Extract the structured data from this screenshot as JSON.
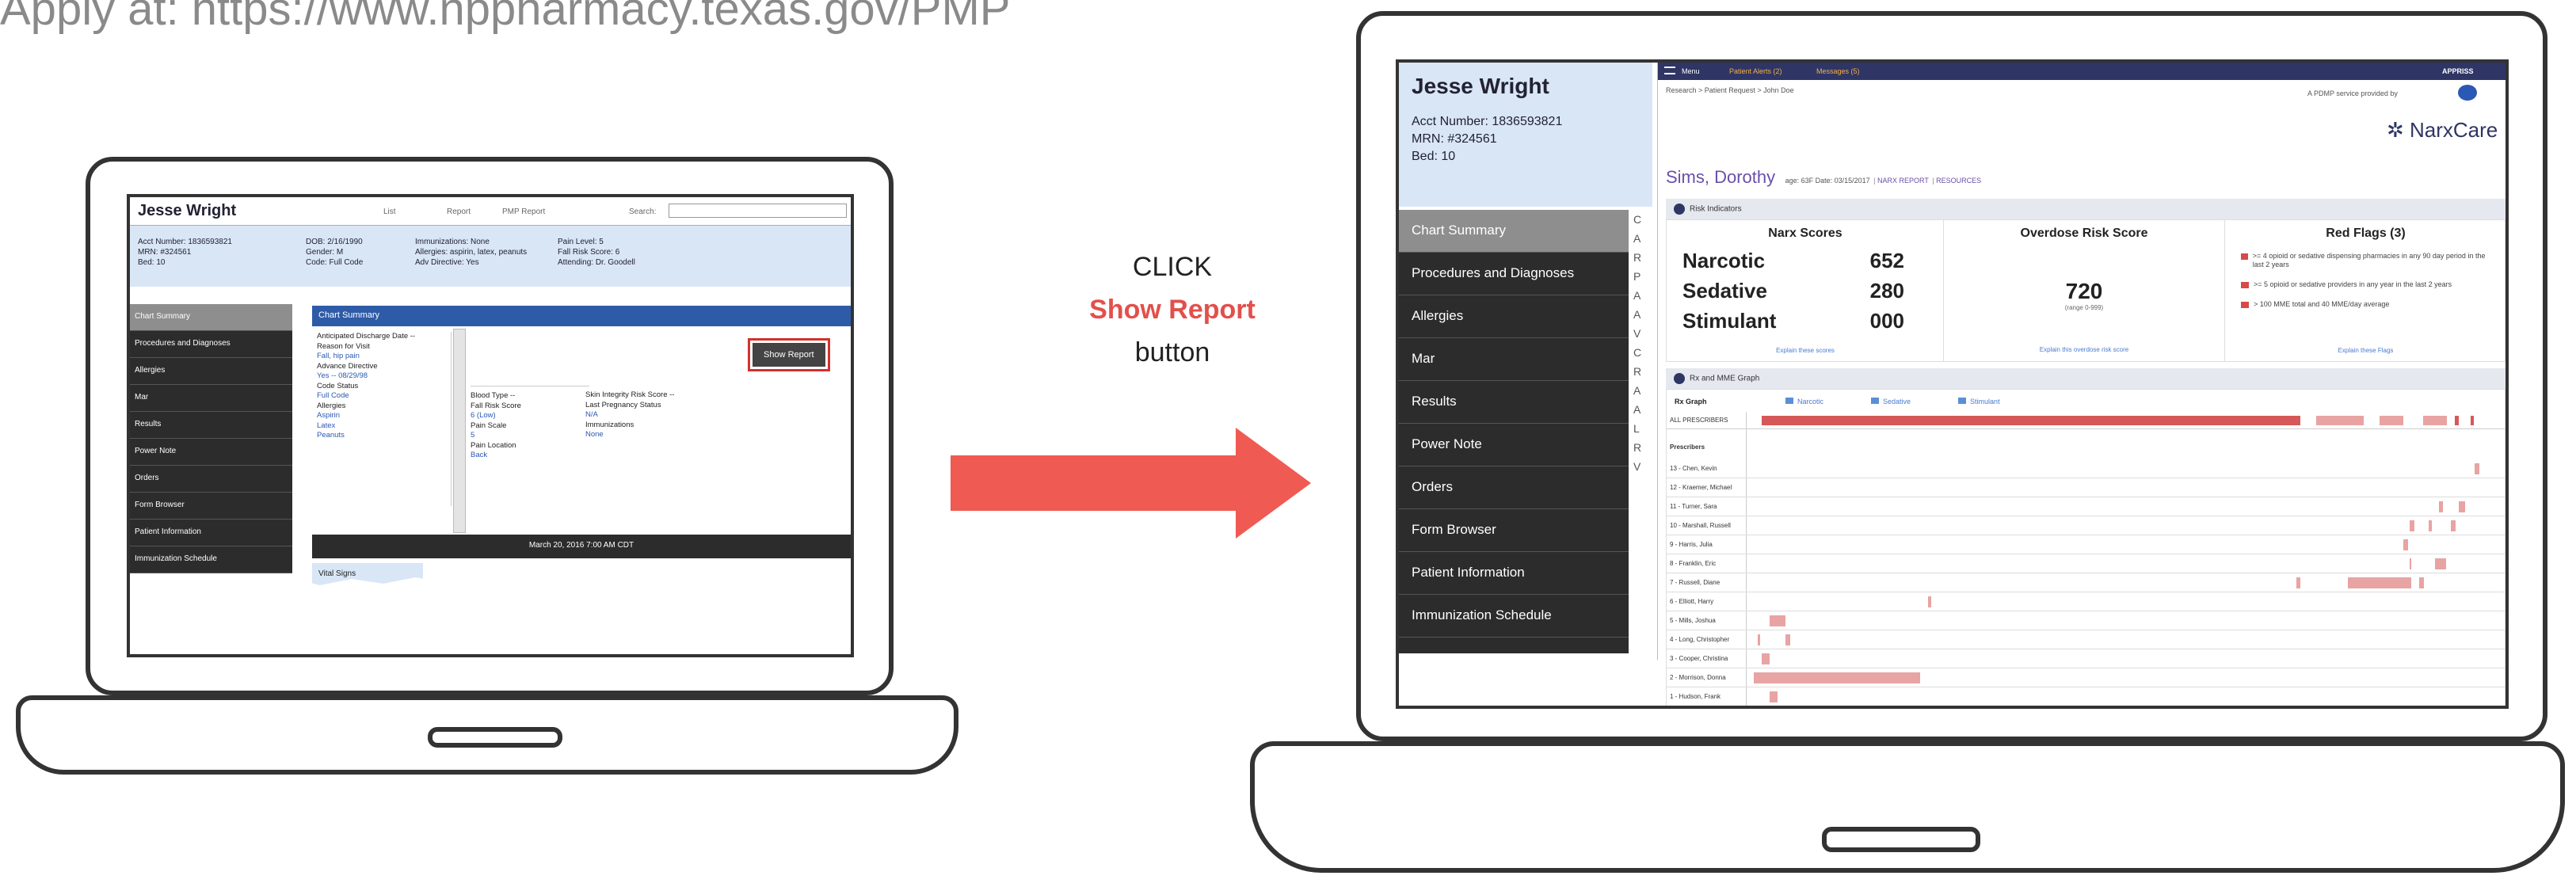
{
  "heading": "Apply at: https://www.nppharmacy.texas.gov/PMP",
  "instruction": {
    "line1": "CLICK",
    "line2": "Show Report",
    "line3": "button"
  },
  "colors": {
    "accent_red": "#e2504c",
    "sidebar": "#2c2c2c",
    "ehr_blue": "#2e5ba8",
    "narx_navy": "#2f3564"
  },
  "left_screen": {
    "patient_name": "Jesse Wright",
    "tabs": [
      "List",
      "Report",
      "PMP Report",
      "Search:"
    ],
    "info_col1": [
      "Acct Number: 1836593821",
      "MRN: #324561",
      "Bed: 10"
    ],
    "info_col2": [
      "DOB: 2/16/1990",
      "Gender: M",
      "Code: Full Code"
    ],
    "info_col3": [
      "Immunizations: None",
      "Allergies: aspirin, latex, peanuts",
      "Adv Directive: Yes"
    ],
    "info_col4": [
      "Pain Level: 5",
      "Fall Risk Score: 6",
      "Attending: Dr. Goodell"
    ],
    "sidebar": [
      "Chart Summary",
      "Procedures and Diagnoses",
      "Allergies",
      "Mar",
      "Results",
      "Power Note",
      "Orders",
      "Form Browser",
      "Patient Information",
      "Immunization Schedule"
    ],
    "section_title": "Chart Summary",
    "left_list": [
      {
        "text": "Anticipated Discharge Date --",
        "link": false
      },
      {
        "text": "Reason for Visit",
        "link": false
      },
      {
        "text": "Fall, hip pain",
        "link": true
      },
      {
        "text": "Advance Directive",
        "link": false
      },
      {
        "text": "Yes -- 08/29/98",
        "link": true
      },
      {
        "text": "Code Status",
        "link": false
      },
      {
        "text": "Full Code",
        "link": true
      },
      {
        "text": "Allergies",
        "link": false
      },
      {
        "text": "Aspirin",
        "link": true
      },
      {
        "text": "Latex",
        "link": true
      },
      {
        "text": "Peanuts",
        "link": true
      }
    ],
    "show_report_label": "Show Report",
    "mid_list": [
      {
        "text": "Blood Type --",
        "link": false
      },
      {
        "text": "Fall Risk Score",
        "link": false
      },
      {
        "text": "6 (Low)",
        "link": true
      },
      {
        "text": "Pain Scale",
        "link": false
      },
      {
        "text": "5",
        "link": true
      },
      {
        "text": "Pain Location",
        "link": false
      },
      {
        "text": "Back",
        "link": true
      }
    ],
    "right_list": [
      {
        "text": "Skin Integrity Risk Score --",
        "link": false
      },
      {
        "text": "Last Pregnancy Status",
        "link": false
      },
      {
        "text": "N/A",
        "link": true
      },
      {
        "text": "Immunizations",
        "link": false
      },
      {
        "text": "None",
        "link": true
      }
    ],
    "footer_date": "March 20, 2016 7:00 AM CDT",
    "vital_signs": "Vital Signs"
  },
  "right_screen": {
    "patient_name": "Jesse Wright",
    "info": [
      "Acct Number: 1836593821",
      "MRN: #324561",
      "Bed: 10"
    ],
    "sidebar": [
      "Chart Summary",
      "Procedures and Diagnoses",
      "Allergies",
      "Mar",
      "Results",
      "Power Note",
      "Orders",
      "Form Browser",
      "Patient Information",
      "Immunization Schedule"
    ],
    "sidebar_letters": [
      "C",
      "A",
      "R",
      "P",
      "A",
      "A",
      "V",
      "C",
      "R",
      "A",
      "A",
      "L",
      "R",
      "V"
    ],
    "topnav": {
      "menu": "Menu",
      "patient_alerts": "Patient Alerts (2)",
      "messages": "Messages (5)",
      "brand": "APPRISS"
    },
    "breadcrumb": "Research > Patient Request > John Doe",
    "provided_by": "A PDMP service provided by",
    "logo": "NarxCare",
    "report_header": {
      "name": "Sims, Dorothy",
      "meta": "age: 63F   Date: 03/15/2017",
      "links": [
        "NARX REPORT",
        "RESOURCES"
      ]
    },
    "risk_panel_title": "Risk Indicators",
    "narx": {
      "title": "Narx Scores",
      "rows": [
        {
          "label": "Narcotic",
          "value": "652"
        },
        {
          "label": "Sedative",
          "value": "280"
        },
        {
          "label": "Stimulant",
          "value": "000"
        }
      ],
      "explain": "Explain these scores"
    },
    "overdose": {
      "title": "Overdose Risk Score",
      "value": "720",
      "range": "(range 0-999)",
      "explain": "Explain this overdose risk score"
    },
    "red_flags": {
      "title": "Red Flags (3)",
      "items": [
        ">= 4 opioid or sedative dispensing pharmacies in any 90 day period in the last 2 years",
        ">= 5 opioid or sedative providers in any year in the last 2 years",
        "> 100 MME total and 40 MME/day average"
      ],
      "explain": "Explain these Flags"
    },
    "graph_panel_title": "Rx and MME Graph",
    "legend": {
      "label": "Rx Graph",
      "items": [
        "Narcotic",
        "Sedative",
        "Stimulant"
      ]
    },
    "all_prescribers": "ALL PRESCRIBERS",
    "prescribers_heading": "Prescribers",
    "prescribers": [
      "13 - Chen, Kevin",
      "12 - Kraemer, Michael",
      "11 - Turner, Sara",
      "10 - Marshall, Russell",
      "9 - Harris, Julia",
      "8 - Franklin, Eric",
      "7 - Russell, Diane",
      "6 - Elliott, Harry",
      "5 - Mills, Joshua",
      "4 - Long, Christopher",
      "3 - Cooper, Christina",
      "2 - Morrison, Donna",
      "1 - Hudson, Frank"
    ]
  }
}
